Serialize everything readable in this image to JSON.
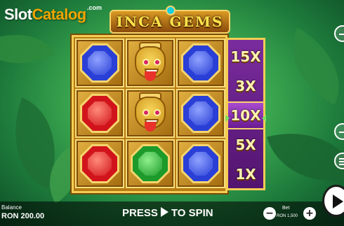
{
  "watermark": {
    "slot": "Slot",
    "catalog": "Catalog",
    "com": ".com"
  },
  "logo": {
    "title": "INCA GEMS"
  },
  "reels": [
    [
      "blue-gem",
      "inca-mask",
      "blue-gem"
    ],
    [
      "red-gem",
      "inca-mask",
      "blue-gem"
    ],
    [
      "red-gem",
      "green-gem",
      "blue-gem"
    ]
  ],
  "symbols": {
    "blue-gem": {
      "color": "#2a3fd6",
      "light": "#8fa2ff"
    },
    "red-gem": {
      "color": "#d1141c",
      "light": "#ff8a7a"
    },
    "green-gem": {
      "color": "#1c9a2a",
      "light": "#8ff08a"
    }
  },
  "multipliers": [
    "15X",
    "3X",
    "10X",
    "5X",
    "1X"
  ],
  "active_multiplier": "10X",
  "bottom": {
    "balance_label": "Balance",
    "balance_value": "RON 200.00",
    "spin_prefix": "PRESS",
    "spin_suffix": "TO SPIN",
    "bet_label": "Bet",
    "bet_value": "RON 1,500"
  },
  "colors": {
    "frame": "#f3cd55",
    "multiplier_bg": "#7a2c9e",
    "accent": "#f0a400"
  }
}
